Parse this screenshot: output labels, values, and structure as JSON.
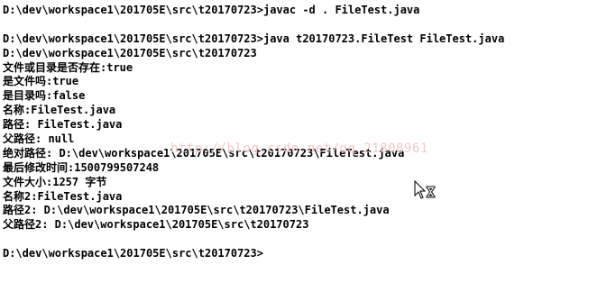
{
  "console": {
    "lines": [
      "D:\\dev\\workspace1\\201705E\\src\\t20170723>javac -d . FileTest.java",
      "",
      "D:\\dev\\workspace1\\201705E\\src\\t20170723>java t20170723.FileTest FileTest.java",
      "D:\\dev\\workspace1\\201705E\\src\\t20170723",
      "文件或目录是否存在:true",
      "是文件吗:true",
      "是目录吗:false",
      "名称:FileTest.java",
      "路径: FileTest.java",
      "父路径: null",
      "绝对路径: D:\\dev\\workspace1\\201705E\\src\\t20170723\\FileTest.java",
      "最后修改时间:1500799507248",
      "文件大小:1257 字节",
      "名称2:FileTest.java",
      "路径2: D:\\dev\\workspace1\\201705E\\src\\t20170723\\FileTest.java",
      "父路径2: D:\\dev\\workspace1\\201705E\\src\\t20170723",
      "",
      "D:\\dev\\workspace1\\201705E\\src\\t20170723>"
    ]
  },
  "watermark": {
    "text": "http://blog.csdn.net/qq_21808961"
  },
  "cursor": {
    "icon": "busy-cursor-icon"
  }
}
